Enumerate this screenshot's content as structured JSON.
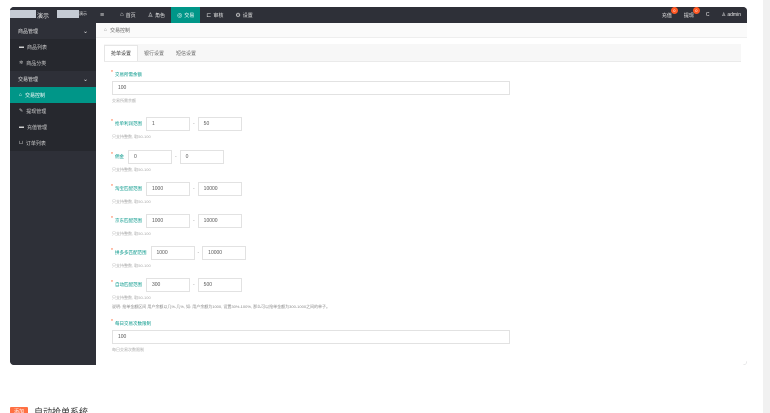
{
  "app": {
    "logo_text_1": "演示",
    "logo_text_2": "演示"
  },
  "topnav": {
    "items": [
      {
        "label": "首页",
        "icon": "home-icon",
        "glyph": "⌂"
      },
      {
        "label": "角色",
        "icon": "user-icon",
        "glyph": "♙"
      },
      {
        "label": "交易",
        "icon": "trade-icon",
        "glyph": "◎"
      },
      {
        "label": "审核",
        "icon": "audit-icon",
        "glyph": "⊏"
      },
      {
        "label": "设置",
        "icon": "gear-icon",
        "glyph": "⚙"
      }
    ],
    "active_index": 2
  },
  "topright": {
    "recharge": "充值",
    "recharge_badge": "0",
    "withdraw": "提现",
    "withdraw_badge": "0",
    "refresh_glyph": "C",
    "user": "admin"
  },
  "sidebar": {
    "groups": [
      {
        "label": "商品管理",
        "items": [
          {
            "label": "商品列表",
            "icon": "cart-icon",
            "glyph": "▬"
          },
          {
            "label": "商品分类",
            "icon": "category-icon",
            "glyph": "✲"
          }
        ]
      },
      {
        "label": "交易管理",
        "items": [
          {
            "label": "交易控制",
            "icon": "control-icon",
            "glyph": "⌂"
          },
          {
            "label": "提现管理",
            "icon": "withdraw-icon",
            "glyph": "✎"
          },
          {
            "label": "充值管理",
            "icon": "recharge-icon",
            "glyph": "▬"
          },
          {
            "label": "订单列表",
            "icon": "order-icon",
            "glyph": "⊔"
          }
        ]
      }
    ]
  },
  "breadcrumb": {
    "home_glyph": "⌂",
    "current": "交易控制"
  },
  "tabs": [
    "抢单设置",
    "银行设置",
    "短信设置"
  ],
  "form": {
    "f1": {
      "label": "交易所需余额",
      "value": "100",
      "hint": "交易所需余额"
    },
    "f2": {
      "label": "抢单利润范围",
      "min": "1",
      "max": "50",
      "hint": "只支持整数, 取50-100"
    },
    "f3": {
      "label": "佣金",
      "min": "0",
      "max": "0",
      "hint": "只支持整数, 取50-100"
    },
    "f4": {
      "label": "淘宝匹配范围",
      "min": "1000",
      "max": "10000",
      "hint": "只支持整数, 取50-100"
    },
    "f5": {
      "label": "京东匹配范围",
      "min": "1000",
      "max": "10000",
      "hint": "只支持整数, 取50-100"
    },
    "f6": {
      "label": "拼多多匹配范围",
      "min": "1000",
      "max": "10000",
      "hint": "只支持整数, 取50-100"
    },
    "f7": {
      "label": "自动匹配范围",
      "min": "300",
      "max": "500",
      "hint": "只支持整数, 取50-100"
    },
    "note": "说明: 抢单金额区间 用户余额以几%-几%, 如: 用户余额为1000, 设置30%-100%, 那么可以抢单金额为300-1000之间的单子。",
    "f8": {
      "label": "每日交易次数限制",
      "value": "100",
      "hint": "每日交易次数限制"
    }
  },
  "footer": {
    "tag": "添加",
    "title": "自动抢单系统"
  }
}
